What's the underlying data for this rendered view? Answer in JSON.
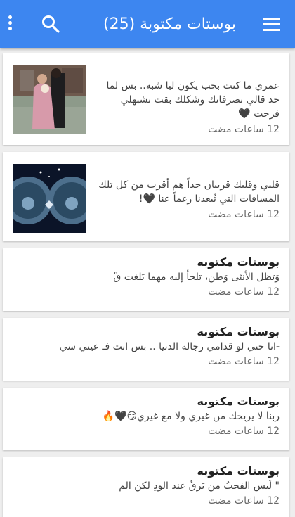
{
  "header": {
    "title": "بوستات مكتوبة (25)"
  },
  "posts": [
    {
      "body": "عمري ما كنت بحب يكون ليا شبه.. بس لما حد قالي تصرفاتك وشكلك بقت تشبهلي فرحت 🖤",
      "time": "12 ساعات مضت"
    },
    {
      "body": "قلبي وقلبك قريبان جداً هم أقرب من كل تلك المسافات التي تُبعدنا رغماً عنا 🖤!",
      "time": "12 ساعات مضت"
    },
    {
      "heading": "بوستات مكتوبه",
      "body": "وَتظل الأنثى وَطن، تلجأ إليه مهما بَلغت قْ",
      "time": "12 ساعات مضت"
    },
    {
      "heading": "بوستات مكتوبه",
      "body": "-انا حتي لو قدامي رجاله الدنيا .. بس انت فـ عيني سي",
      "time": "12 ساعات مضت"
    },
    {
      "heading": "بوستات مكتوبه",
      "body": "ربنا لا يريحك من غيري ولا مع غيري😏🖤🔥",
      "time": "12 ساعات مضت"
    },
    {
      "heading": "بوستات مكتوبه",
      "body": "\" لَيس الفجبُ من يَرقُ عند الودِ لكن الم",
      "time": "12 ساعات مضت"
    }
  ]
}
